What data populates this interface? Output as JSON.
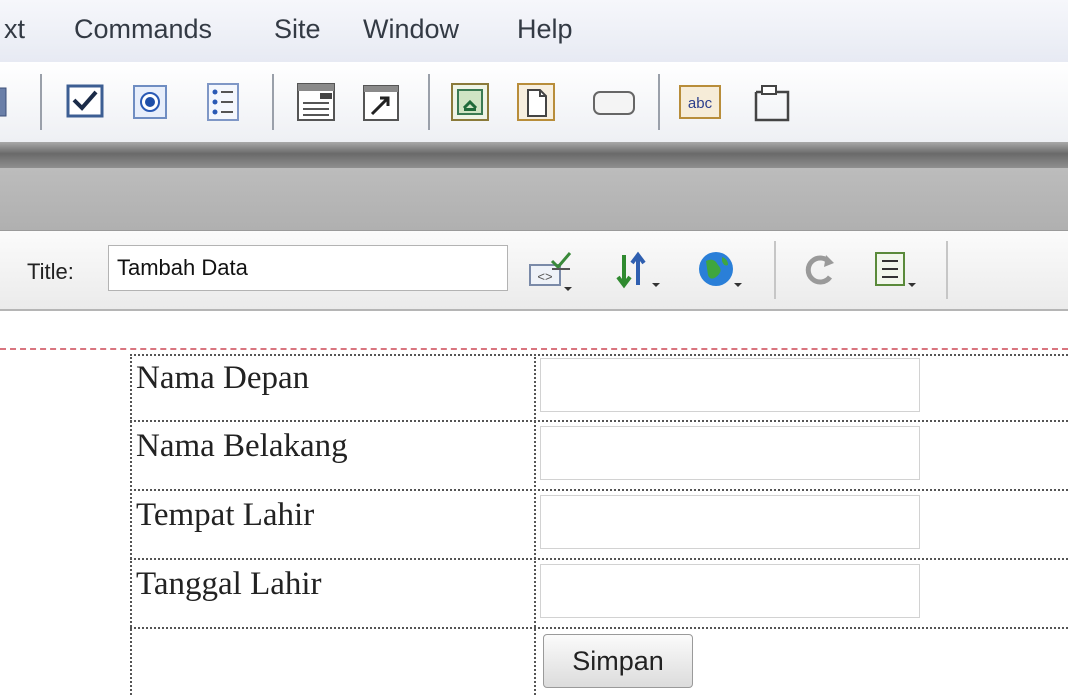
{
  "menubar": {
    "items": [
      "xt",
      "Commands",
      "Site",
      "Window",
      "Help"
    ]
  },
  "insert_toolbar": {
    "icons": [
      "form-element-icon",
      "checkbox-icon",
      "radio-button-icon",
      "radio-group-icon",
      "list-menu-icon",
      "jump-menu-icon",
      "image-field-icon",
      "file-field-icon",
      "button-icon",
      "label-icon",
      "fieldset-icon"
    ],
    "label_icon_text": "abc"
  },
  "document_toolbar": {
    "title_label": "Title:",
    "title_value": "Tambah Data"
  },
  "form": {
    "rows": [
      {
        "label": "Nama Depan",
        "value": ""
      },
      {
        "label": "Nama Belakang",
        "value": ""
      },
      {
        "label": "Tempat Lahir",
        "value": ""
      },
      {
        "label": "Tanggal Lahir",
        "value": ""
      }
    ],
    "submit_label": "Simpan"
  }
}
